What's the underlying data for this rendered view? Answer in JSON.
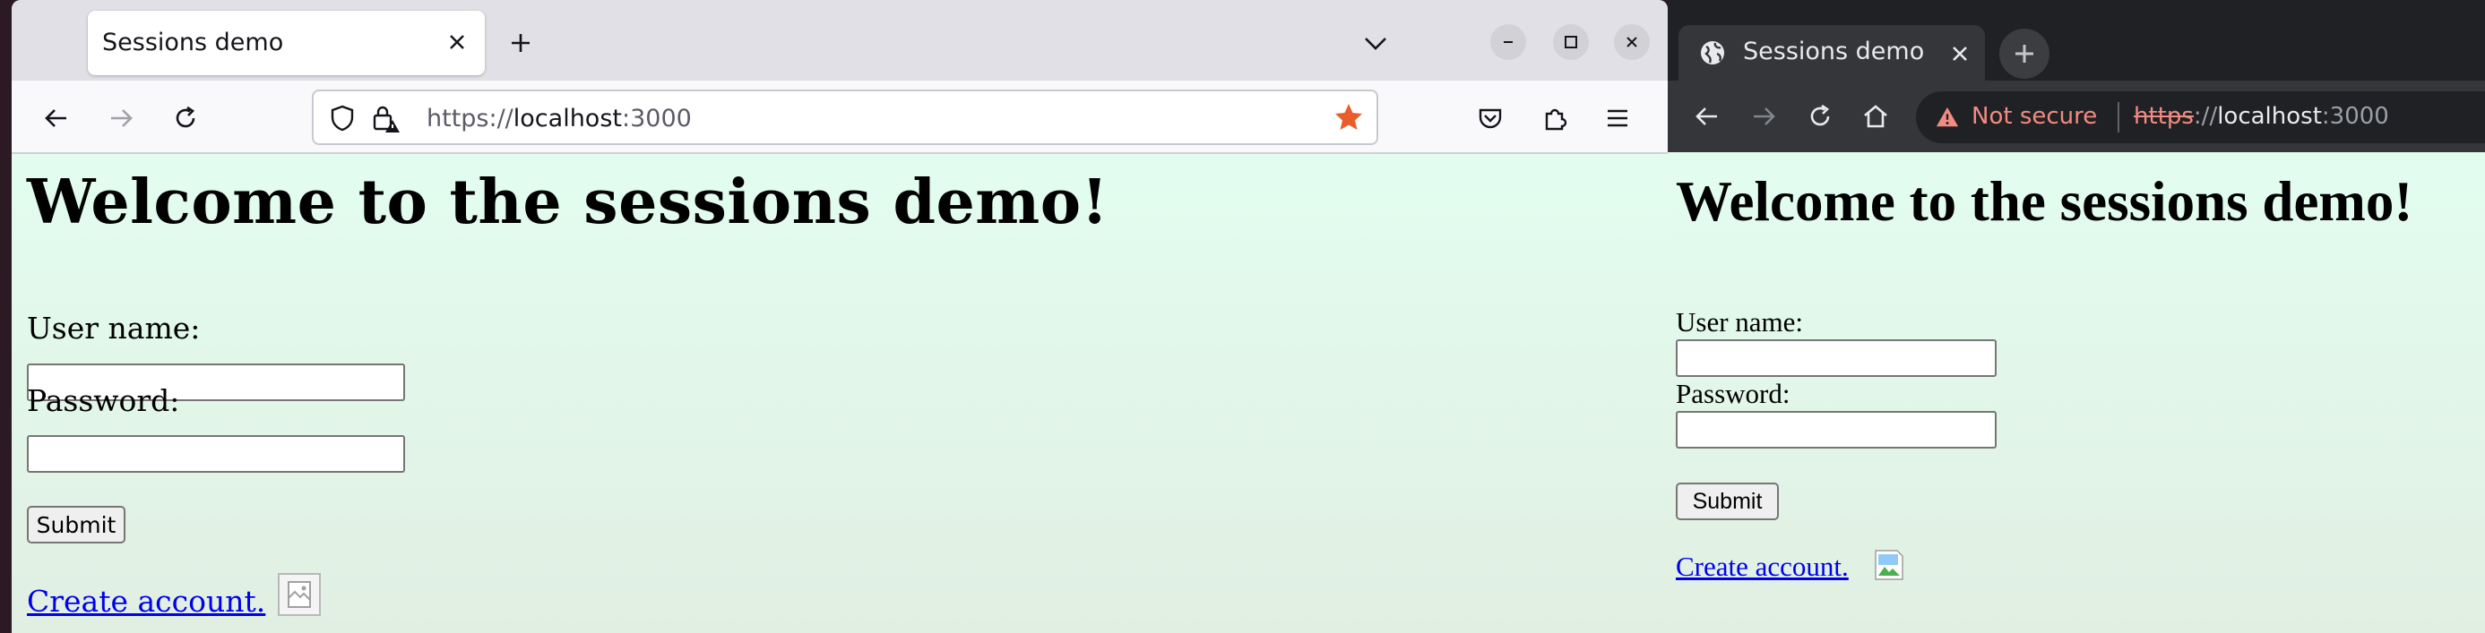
{
  "firefox": {
    "tab": {
      "title": "Sessions demo"
    },
    "toolbar": {
      "url_scheme": "https://",
      "url_host": "localhost",
      "url_port": ":3000"
    },
    "page": {
      "heading": "Welcome to the sessions demo!",
      "username_label": "User name:",
      "password_label": "Password:",
      "username_value": "",
      "password_value": "",
      "submit_label": "Submit",
      "create_account_link": "Create account."
    }
  },
  "chrome": {
    "tab": {
      "title": "Sessions demo"
    },
    "omnibox": {
      "security_label": "Not secure",
      "url_scheme": "https",
      "url_sep": "://",
      "url_host": "localhost",
      "url_port": ":3000"
    },
    "page": {
      "heading": "Welcome to the sessions demo!",
      "username_label": "User name:",
      "password_label": "Password:",
      "username_value": "",
      "password_value": "",
      "submit_label": "Submit",
      "create_account_link": "Create account."
    }
  },
  "colors": {
    "page_bg_top": "#e2fdf0",
    "page_bg_bottom": "#e1efe2",
    "link": "#0000ee",
    "bookmark_star": "#e95d2c",
    "not_secure": "#f28b82"
  }
}
